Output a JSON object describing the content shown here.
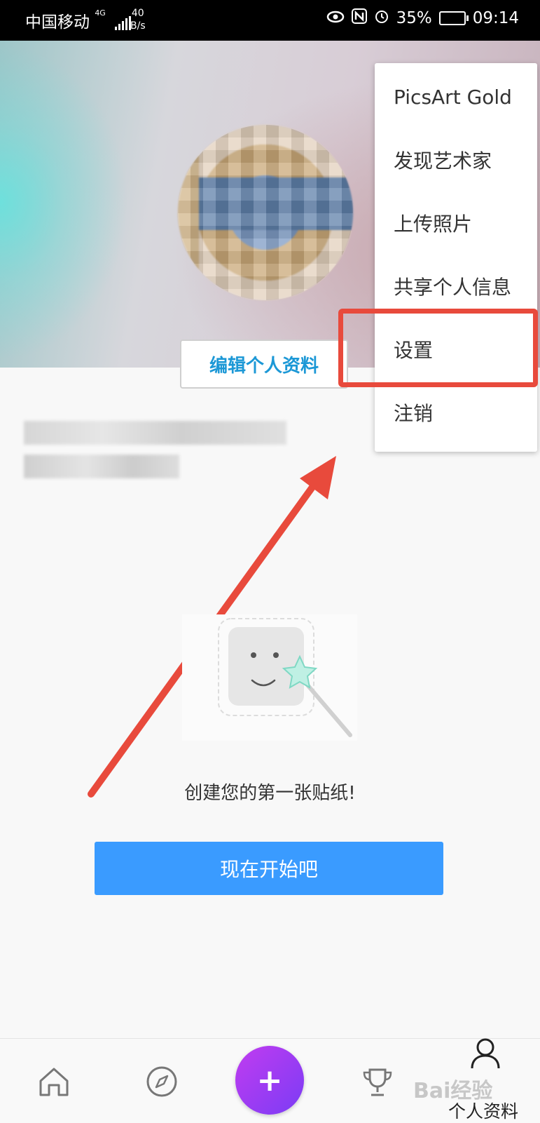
{
  "status_bar": {
    "carrier": "中国移动",
    "network": "4G",
    "speed_value": "40",
    "speed_unit": "B/s",
    "battery": "35%",
    "time": "09:14",
    "icons": [
      "eye-icon",
      "nfc-icon",
      "alarm-icon",
      "battery-icon",
      "signal-icon"
    ]
  },
  "profile": {
    "edit_button": "编辑个人资料"
  },
  "menu": {
    "items": [
      {
        "label": "PicsArt Gold"
      },
      {
        "label": "发现艺术家"
      },
      {
        "label": "上传照片"
      },
      {
        "label": "共享个人信息"
      },
      {
        "label": "设置",
        "highlighted": true
      },
      {
        "label": "注销"
      }
    ]
  },
  "empty_state": {
    "message": "创建您的第一张贴纸!",
    "button": "现在开始吧"
  },
  "bottom_nav": {
    "items": [
      {
        "icon": "home-icon"
      },
      {
        "icon": "compass-icon"
      },
      {
        "icon": "plus-icon",
        "label": "+"
      },
      {
        "icon": "trophy-icon"
      },
      {
        "icon": "profile-icon",
        "label": "个人资料"
      }
    ]
  },
  "annotations": {
    "highlight_color": "#e84a3c",
    "arrow_color": "#e84a3c"
  },
  "colors": {
    "accent_blue": "#3a9bff",
    "link_blue": "#1c98d6",
    "fab_gradient_start": "#c13cf0",
    "fab_gradient_end": "#7b3cf5"
  }
}
